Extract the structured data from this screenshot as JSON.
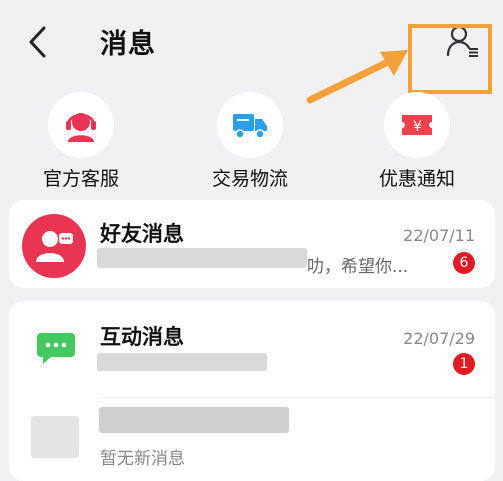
{
  "header": {
    "title": "消息",
    "back_icon": "back-chevron-icon",
    "contacts_icon": "contacts-list-icon"
  },
  "annotation": {
    "arrow_color": "#f5a13b",
    "box_color": "#f5a13b"
  },
  "quick_actions": [
    {
      "label": "官方客服",
      "icon": "customer-service-icon",
      "color": "#ea3453"
    },
    {
      "label": "交易物流",
      "icon": "delivery-truck-icon",
      "color": "#2ba0e8"
    },
    {
      "label": "优惠通知",
      "icon": "coupon-icon",
      "color": "#f0414d"
    }
  ],
  "messages": [
    {
      "title": "好友消息",
      "date": "22/07/11",
      "preview_visible": "叻，希望你...",
      "unread": "6",
      "icon": "friend-avatar-icon"
    },
    {
      "title": "互动消息",
      "date": "22/07/29",
      "unread": "1",
      "icon": "chat-bubble-icon"
    },
    {
      "preview": "暂无新消息"
    }
  ],
  "colors": {
    "accent_red": "#e01b24",
    "page_bg": "#f1f1f3"
  }
}
